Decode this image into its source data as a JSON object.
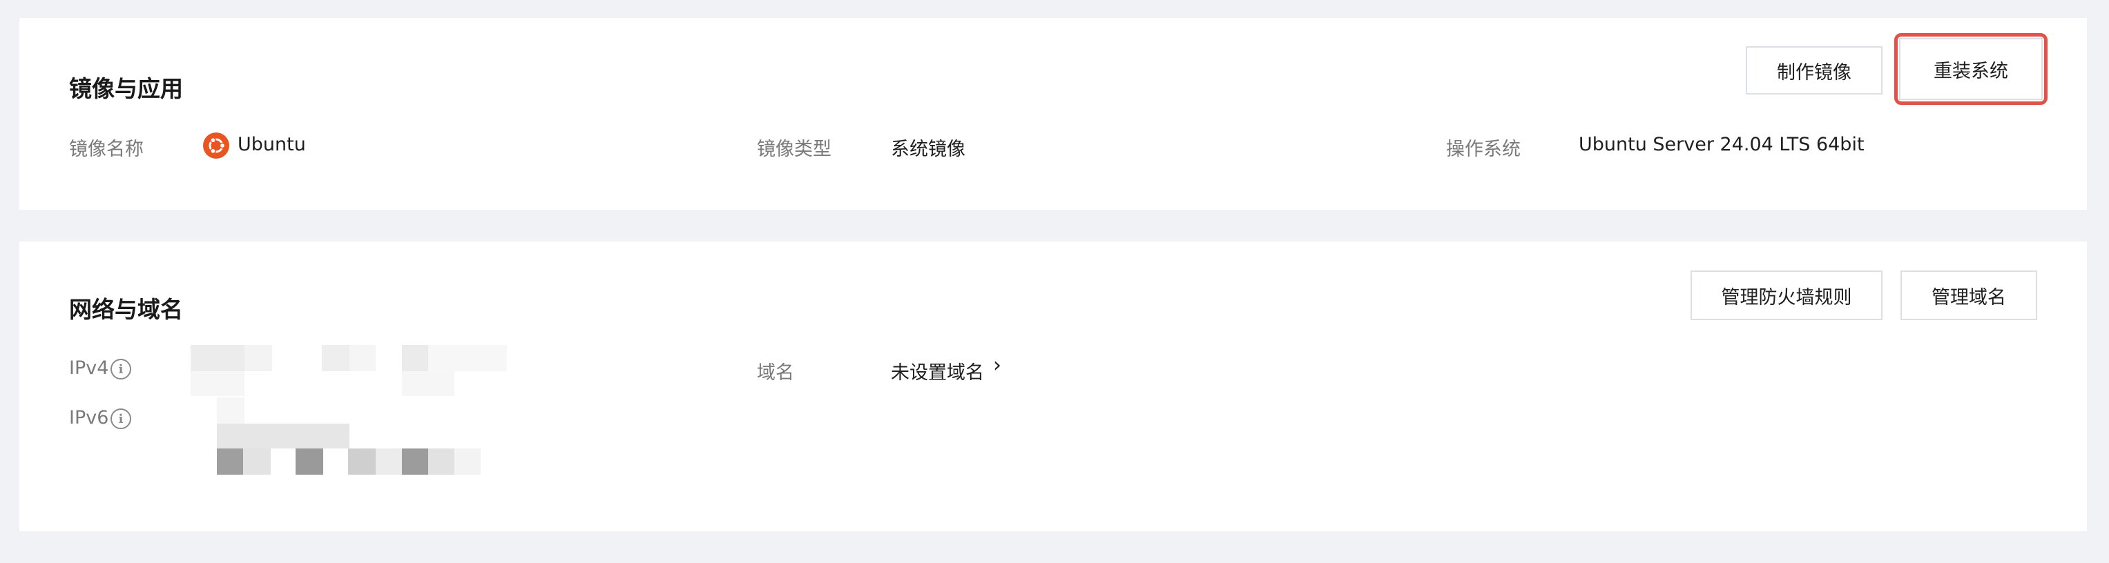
{
  "image_section": {
    "title": "镜像与应用",
    "buttons": {
      "create_image": "制作镜像",
      "reinstall": "重装系统"
    },
    "fields": {
      "image_name_label": "镜像名称",
      "image_name_value": "Ubuntu",
      "image_type_label": "镜像类型",
      "image_type_value": "系统镜像",
      "os_label": "操作系统",
      "os_value": "Ubuntu Server 24.04 LTS 64bit"
    }
  },
  "network_section": {
    "title": "网络与域名",
    "buttons": {
      "firewall": "管理防火墙规则",
      "domain": "管理域名"
    },
    "fields": {
      "ipv4_label": "IPv4",
      "ipv6_label": "IPv6",
      "info_glyph": "i",
      "domain_label": "域名",
      "domain_value": "未设置域名",
      "domain_chevron": "›"
    }
  },
  "colors": {
    "page_bg": "#f1f2f5",
    "highlight": "#e0524a",
    "ubuntu_brand": "#e95420"
  }
}
